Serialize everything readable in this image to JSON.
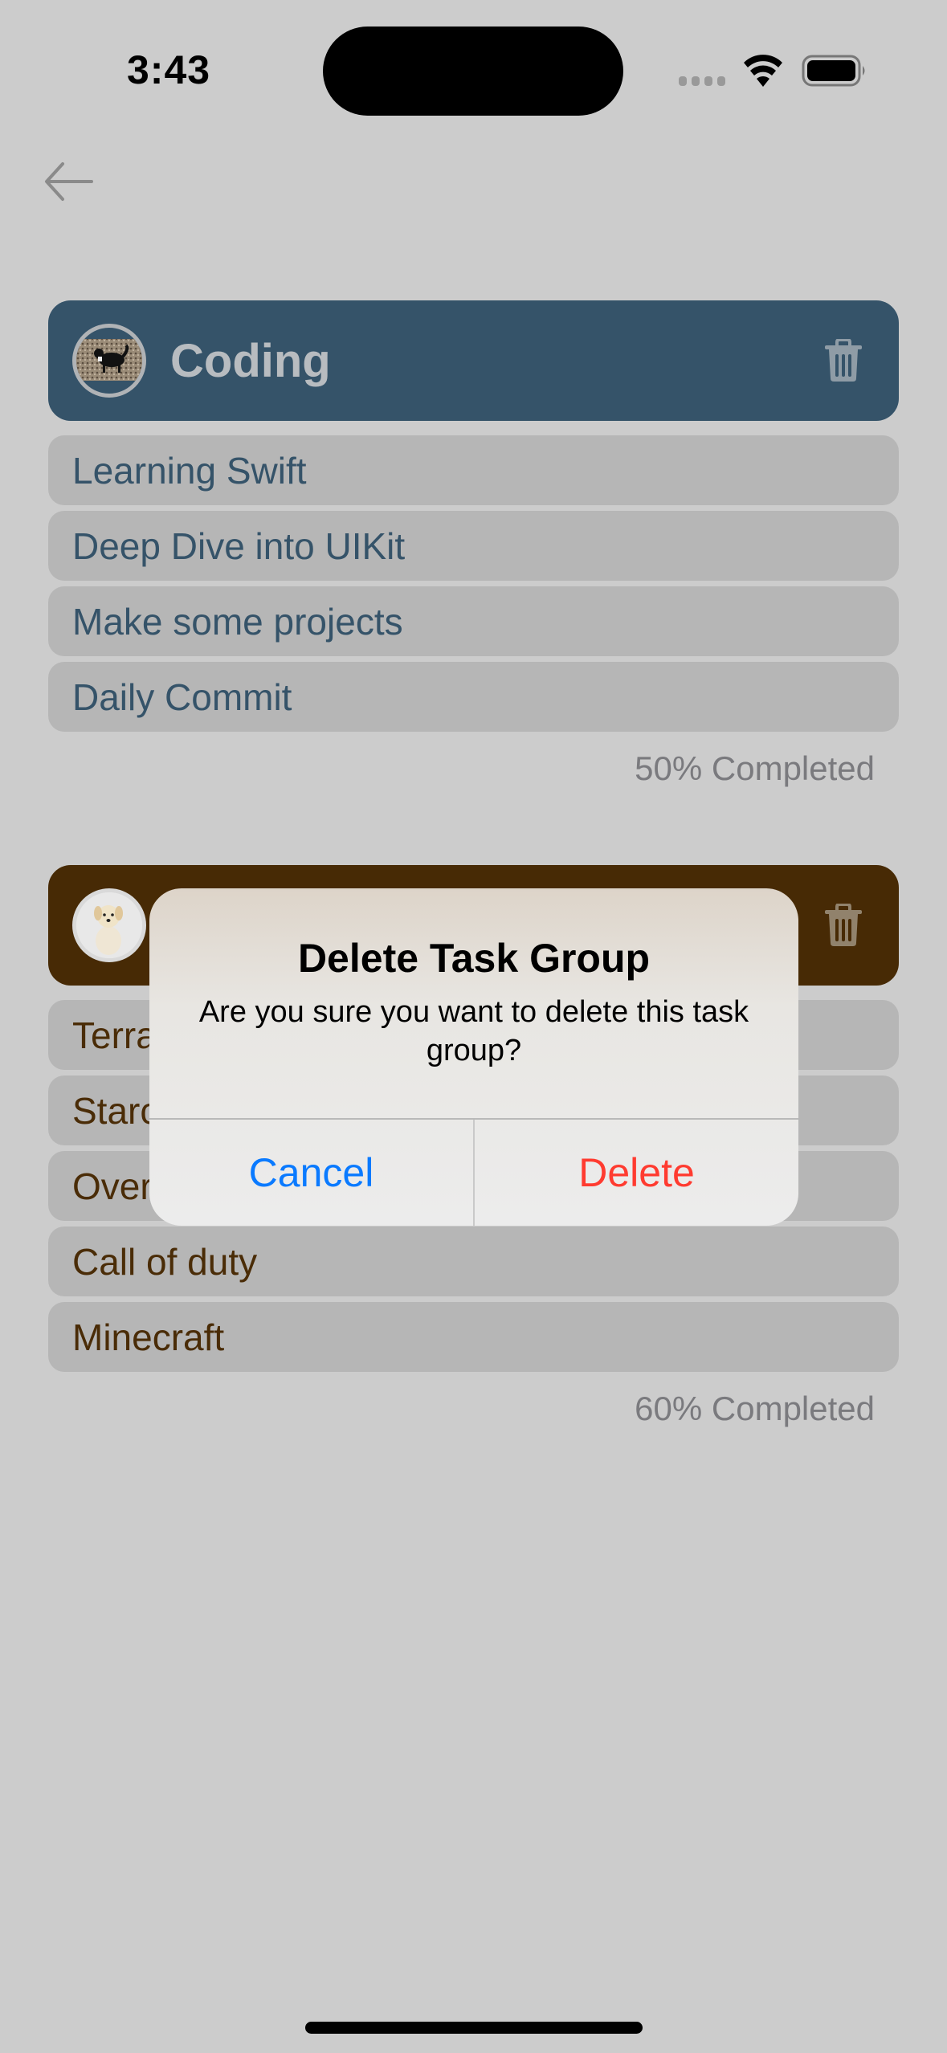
{
  "status_bar": {
    "time": "3:43",
    "icons": [
      "signal-dots-icon",
      "wifi-icon",
      "battery-icon"
    ]
  },
  "nav": {
    "back_icon": "arrow-left-icon"
  },
  "groups": [
    {
      "title": "Coding",
      "avatar": "dog-photo-avatar",
      "header_color": "#355369",
      "text_color": "#355369",
      "delete_icon": "trash-icon",
      "tasks": [
        "Learning Swift",
        "Deep Dive into UIKit",
        "Make some projects",
        "Daily Commit"
      ],
      "progress_percent": 50,
      "progress_label": "50% Completed"
    },
    {
      "title": "",
      "avatar": "puppy-photo-avatar",
      "header_color": "#472a05",
      "text_color": "#4a2c07",
      "delete_icon": "trash-icon",
      "tasks": [
        "Terra",
        "Starc",
        "Over",
        "Call of duty",
        "Minecraft"
      ],
      "progress_percent": 60,
      "progress_label": "60% Completed"
    }
  ],
  "alert": {
    "title": "Delete Task Group",
    "message": "Are you sure you want to delete this task group?",
    "cancel_label": "Cancel",
    "delete_label": "Delete",
    "cancel_color": "#0a7aff",
    "delete_color": "#ff3b30"
  }
}
